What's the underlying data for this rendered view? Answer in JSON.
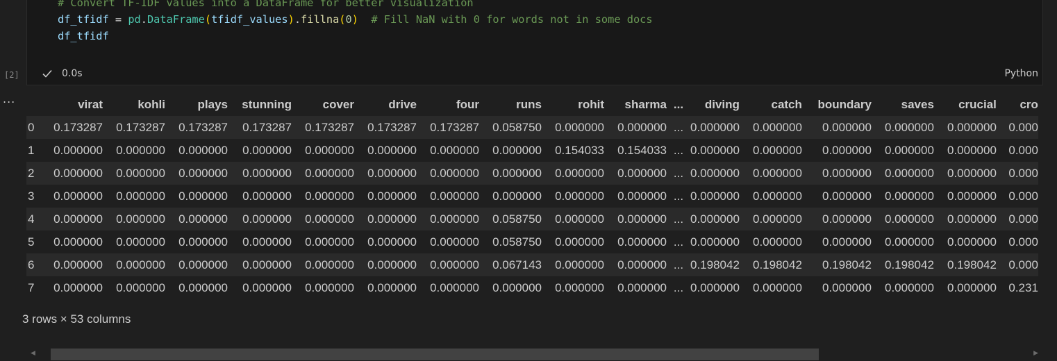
{
  "cell": {
    "execution_count": "[2]",
    "code_lines": [
      [
        {
          "t": "# Convert TF-IDF values into a DataFrame for better visualization",
          "c": "c-comment"
        }
      ],
      [
        {
          "t": "df_tfidf",
          "c": "c-var"
        },
        {
          "t": " = ",
          "c": "c-op"
        },
        {
          "t": "pd",
          "c": "c-mod"
        },
        {
          "t": ".",
          "c": "c-op"
        },
        {
          "t": "DataFrame",
          "c": "c-mod"
        },
        {
          "t": "(",
          "c": "c-paren"
        },
        {
          "t": "tfidf_values",
          "c": "c-var"
        },
        {
          "t": ")",
          "c": "c-paren"
        },
        {
          "t": ".",
          "c": "c-op"
        },
        {
          "t": "fillna",
          "c": "c-fn"
        },
        {
          "t": "(",
          "c": "c-paren"
        },
        {
          "t": "0",
          "c": "c-num"
        },
        {
          "t": ")",
          "c": "c-paren"
        },
        {
          "t": "  # Fill NaN with 0 for words not in some docs",
          "c": "c-comment"
        }
      ],
      [
        {
          "t": "df_tfidf",
          "c": "c-var"
        }
      ]
    ],
    "exec_time": "0.0s",
    "language": "Python"
  },
  "output": {
    "menu_label": "...",
    "columns": [
      "virat",
      "kohli",
      "plays",
      "stunning",
      "cover",
      "drive",
      "four",
      "runs",
      "rohit",
      "sharma",
      "...",
      "diving",
      "catch",
      "boundary",
      "saves",
      "crucial",
      "cro"
    ],
    "rows": [
      {
        "index": "0",
        "cells": [
          "0.173287",
          "0.173287",
          "0.173287",
          "0.173287",
          "0.173287",
          "0.173287",
          "0.173287",
          "0.058750",
          "0.000000",
          "0.000000",
          "...",
          "0.000000",
          "0.000000",
          "0.000000",
          "0.000000",
          "0.000000",
          "0.000"
        ]
      },
      {
        "index": "1",
        "cells": [
          "0.000000",
          "0.000000",
          "0.000000",
          "0.000000",
          "0.000000",
          "0.000000",
          "0.000000",
          "0.000000",
          "0.154033",
          "0.154033",
          "...",
          "0.000000",
          "0.000000",
          "0.000000",
          "0.000000",
          "0.000000",
          "0.000"
        ]
      },
      {
        "index": "2",
        "cells": [
          "0.000000",
          "0.000000",
          "0.000000",
          "0.000000",
          "0.000000",
          "0.000000",
          "0.000000",
          "0.000000",
          "0.000000",
          "0.000000",
          "...",
          "0.000000",
          "0.000000",
          "0.000000",
          "0.000000",
          "0.000000",
          "0.000"
        ]
      },
      {
        "index": "3",
        "cells": [
          "0.000000",
          "0.000000",
          "0.000000",
          "0.000000",
          "0.000000",
          "0.000000",
          "0.000000",
          "0.000000",
          "0.000000",
          "0.000000",
          "...",
          "0.000000",
          "0.000000",
          "0.000000",
          "0.000000",
          "0.000000",
          "0.000"
        ]
      },
      {
        "index": "4",
        "cells": [
          "0.000000",
          "0.000000",
          "0.000000",
          "0.000000",
          "0.000000",
          "0.000000",
          "0.000000",
          "0.058750",
          "0.000000",
          "0.000000",
          "...",
          "0.000000",
          "0.000000",
          "0.000000",
          "0.000000",
          "0.000000",
          "0.000"
        ]
      },
      {
        "index": "5",
        "cells": [
          "0.000000",
          "0.000000",
          "0.000000",
          "0.000000",
          "0.000000",
          "0.000000",
          "0.000000",
          "0.058750",
          "0.000000",
          "0.000000",
          "...",
          "0.000000",
          "0.000000",
          "0.000000",
          "0.000000",
          "0.000000",
          "0.000"
        ]
      },
      {
        "index": "6",
        "cells": [
          "0.000000",
          "0.000000",
          "0.000000",
          "0.000000",
          "0.000000",
          "0.000000",
          "0.000000",
          "0.067143",
          "0.000000",
          "0.000000",
          "...",
          "0.198042",
          "0.198042",
          "0.198042",
          "0.198042",
          "0.198042",
          "0.000"
        ]
      },
      {
        "index": "7",
        "cells": [
          "0.000000",
          "0.000000",
          "0.000000",
          "0.000000",
          "0.000000",
          "0.000000",
          "0.000000",
          "0.000000",
          "0.000000",
          "0.000000",
          "...",
          "0.000000",
          "0.000000",
          "0.000000",
          "0.000000",
          "0.000000",
          "0.231"
        ]
      }
    ],
    "shape_text": "3 rows × 53 columns"
  },
  "scrollbar": {
    "left_arrow": "◀",
    "right_arrow": "▶"
  }
}
